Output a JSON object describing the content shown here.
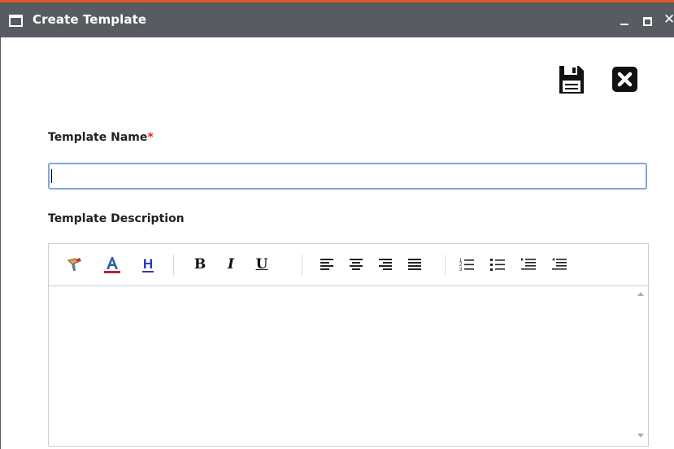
{
  "window": {
    "title": "Create Template",
    "accent_color": "#e2582a",
    "titlebar_color": "#585b61",
    "controls": {
      "minimize": "minimize-icon",
      "maximize": "maximize-icon",
      "close": "close-icon"
    }
  },
  "actions": {
    "save_icon": "save-floppy-icon",
    "cancel_icon": "close-box-icon"
  },
  "form": {
    "name_label": "Template Name",
    "required_mark": "*",
    "name_value": "",
    "description_label": "Template Description"
  },
  "editor": {
    "toolbar": [
      {
        "name": "format-painter-icon"
      },
      {
        "name": "font-color-icon",
        "glyph": "A",
        "color": "#b8232b"
      },
      {
        "name": "highlight-icon",
        "glyph": "H",
        "color": "#2b3ab8"
      },
      {
        "name": "bold-icon",
        "glyph": "B"
      },
      {
        "name": "italic-icon",
        "glyph": "I"
      },
      {
        "name": "underline-icon",
        "glyph": "U"
      },
      {
        "name": "align-left-icon"
      },
      {
        "name": "align-center-icon"
      },
      {
        "name": "align-right-icon"
      },
      {
        "name": "align-justify-icon"
      },
      {
        "name": "ordered-list-icon"
      },
      {
        "name": "unordered-list-icon"
      },
      {
        "name": "indent-icon"
      },
      {
        "name": "outdent-icon"
      }
    ],
    "content": ""
  }
}
